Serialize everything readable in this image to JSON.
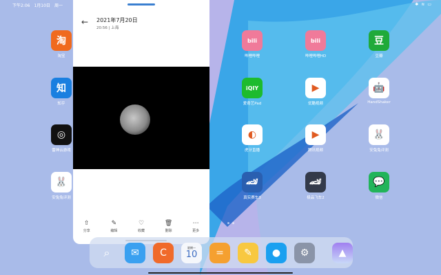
{
  "status": {
    "time": "下午2:06",
    "date": "1月10日",
    "weekday": "周一"
  },
  "window": {
    "title": "2021年7月20日",
    "subtitle": "20:56 | 上海",
    "toolbar": [
      {
        "icon": "share-icon",
        "glyph": "⇧",
        "label": "分享"
      },
      {
        "icon": "edit-icon",
        "glyph": "✎",
        "label": "编辑"
      },
      {
        "icon": "heart-icon",
        "glyph": "♡",
        "label": "收藏"
      },
      {
        "icon": "trash-icon",
        "glyph": "🗑",
        "label": "删除"
      },
      {
        "icon": "more-icon",
        "glyph": "⋯",
        "label": "更多"
      }
    ]
  },
  "apps": [
    {
      "label": "淘宝",
      "glyph": "淘",
      "color": "#f06a1e"
    },
    {
      "label": "知乎",
      "glyph": "知",
      "color": "#1a7fe0"
    },
    {
      "label": "雷神云游戏",
      "glyph": "◎",
      "color": "#111111"
    },
    {
      "label": "安兔兔评测",
      "glyph": "🐰",
      "color": "#ffffff"
    },
    {
      "label": "哔哩哔哩",
      "glyph": "bili",
      "color": "#f07a9a"
    },
    {
      "label": "哔哩哔哩HD",
      "glyph": "bili",
      "color": "#f07a9a"
    },
    {
      "label": "豆瓣",
      "glyph": "豆",
      "color": "#1faa3a"
    },
    {
      "label": "爱奇艺Pad",
      "glyph": "iQIY",
      "color": "#1dbb2d"
    },
    {
      "label": "优酷视频",
      "glyph": "▶",
      "color": "#ffffff"
    },
    {
      "label": "HandShaker",
      "glyph": "🤖",
      "color": "#ffffff"
    },
    {
      "label": "虎牙直播",
      "glyph": "◐",
      "color": "#ffffff"
    },
    {
      "label": "腾讯视频",
      "glyph": "▶",
      "color": "#ffffff"
    },
    {
      "label": "安兔兔评测",
      "glyph": "🐰",
      "color": "#ffffff"
    },
    {
      "label": "真实赛车3",
      "glyph": "🏎",
      "color": "#2a5fb0"
    },
    {
      "label": "极品飞车2",
      "glyph": "🏎",
      "color": "#333a4a"
    },
    {
      "label": "微信",
      "glyph": "💬",
      "color": "#22b45a"
    }
  ],
  "dock": {
    "calendar_day": "10",
    "calendar_weekday": "星期一"
  }
}
